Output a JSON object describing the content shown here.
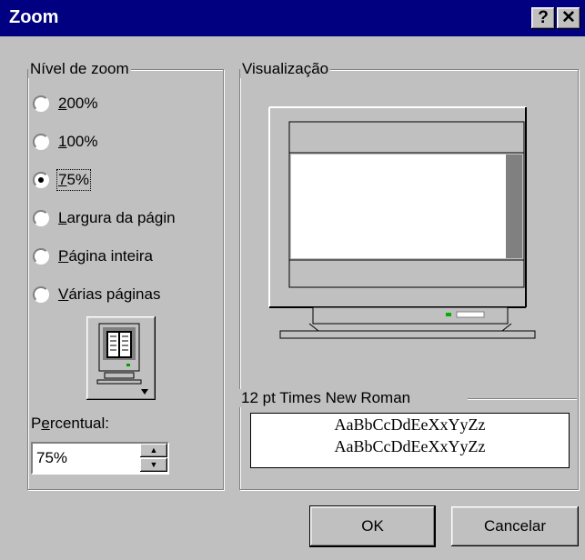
{
  "window": {
    "title": "Zoom",
    "help_label": "?",
    "close_label": "✕"
  },
  "zoom_group": {
    "legend": "Nível de zoom",
    "options": [
      {
        "label": "200%",
        "mnemonic": "2",
        "rest": "00%",
        "selected": false
      },
      {
        "label": "100%",
        "mnemonic": "1",
        "rest": "00%",
        "selected": false
      },
      {
        "label": "75%",
        "mnemonic": "7",
        "rest": "5%",
        "selected": true
      },
      {
        "label": "Largura da págin",
        "mnemonic": "L",
        "rest": "argura da págin",
        "selected": false
      },
      {
        "label": "Página inteira",
        "mnemonic": "P",
        "rest": "ágina inteira",
        "selected": false
      },
      {
        "label": "Várias páginas",
        "mnemonic": "V",
        "rest": "árias páginas",
        "selected": false
      }
    ],
    "percent_label_pre": "P",
    "percent_label_mn": "e",
    "percent_label_post": "rcentual:",
    "percent_value": "75%"
  },
  "preview_group": {
    "legend": "Visualização",
    "font_legend": "12 pt Times New Roman",
    "sample_lines": [
      "AaBbCcDdEeXxYyZz",
      "AaBbCcDdEeXxYyZz"
    ]
  },
  "buttons": {
    "ok": "OK",
    "cancel": "Cancelar"
  },
  "icons": {
    "monitor_preview": "monitor-icon",
    "multi_page": "multi-page-monitor-icon",
    "spin_up": "arrow-up-icon",
    "spin_down": "arrow-down-icon"
  }
}
